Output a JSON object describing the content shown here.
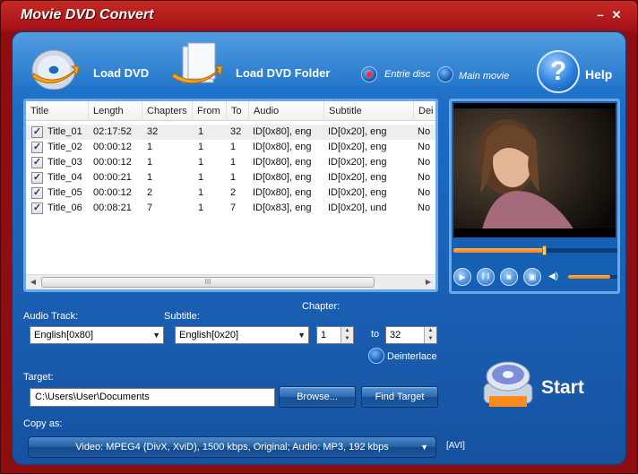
{
  "window": {
    "title": "Movie DVD Convert",
    "minimize_label": "–",
    "close_label": "✕"
  },
  "toolbar": {
    "load_dvd": "Load DVD",
    "load_dvd_folder": "Load DVD Folder",
    "entire_disc": "Entrie disc",
    "main_movie": "Main movie",
    "help": "Help"
  },
  "table": {
    "columns": [
      "Title",
      "Length",
      "Chapters",
      "From",
      "To",
      "Audio",
      "Subtitle",
      "Dei"
    ],
    "rows": [
      {
        "checked": true,
        "title": "Title_01",
        "length": "02:17:52",
        "chapters": "32",
        "from": "1",
        "to": "32",
        "audio": "ID[0x80], eng",
        "subtitle": "ID[0x20], eng",
        "deinterlace": "No"
      },
      {
        "checked": true,
        "title": "Title_02",
        "length": "00:00:12",
        "chapters": "1",
        "from": "1",
        "to": "1",
        "audio": "ID[0x80], eng",
        "subtitle": "ID[0x20], eng",
        "deinterlace": "No"
      },
      {
        "checked": true,
        "title": "Title_03",
        "length": "00:00:12",
        "chapters": "1",
        "from": "1",
        "to": "1",
        "audio": "ID[0x80], eng",
        "subtitle": "ID[0x20], eng",
        "deinterlace": "No"
      },
      {
        "checked": true,
        "title": "Title_04",
        "length": "00:00:21",
        "chapters": "1",
        "from": "1",
        "to": "1",
        "audio": "ID[0x80], eng",
        "subtitle": "ID[0x20], eng",
        "deinterlace": "No"
      },
      {
        "checked": true,
        "title": "Title_05",
        "length": "00:00:12",
        "chapters": "2",
        "from": "1",
        "to": "2",
        "audio": "ID[0x80], eng",
        "subtitle": "ID[0x20], eng",
        "deinterlace": "No"
      },
      {
        "checked": true,
        "title": "Title_06",
        "length": "00:08:21",
        "chapters": "7",
        "from": "1",
        "to": "7",
        "audio": "ID[0x83], eng",
        "subtitle": "ID[0x20], und",
        "deinterlace": "No"
      }
    ],
    "scroll_left": "◀",
    "scroll_right": "▶",
    "scroll_grip": "III"
  },
  "preview": {
    "seek_progress": 0.55,
    "volume_level": 0.85,
    "play_icon": "▶",
    "pause_icon": "❙❙",
    "stop_icon": "■",
    "snapshot_icon": "▣",
    "volume_icon": "◀)"
  },
  "options": {
    "audio_track_label": "Audio Track:",
    "audio_track_value": "English[0x80]",
    "subtitle_label": "Subtitle:",
    "subtitle_value": "English[0x20]",
    "chapter_label": "Chapter:",
    "chapter_from": "1",
    "chapter_to_label": "to",
    "chapter_to": "32",
    "deinterlace_label": "Deinterlace"
  },
  "target": {
    "label": "Target:",
    "path": "C:\\Users\\User\\Documents",
    "browse": "Browse...",
    "find_target": "Find Target"
  },
  "copy": {
    "label": "Copy as:",
    "profile": "Video: MPEG4 (DivX, XviD), 1500 kbps, Original; Audio: MP3, 192 kbps",
    "format": "[AVI]"
  },
  "start": {
    "label": "Start"
  },
  "colors": {
    "client_blue": "#1b6cc3",
    "title_red": "#a8141a",
    "accent_orange": "#ff8a1e"
  }
}
